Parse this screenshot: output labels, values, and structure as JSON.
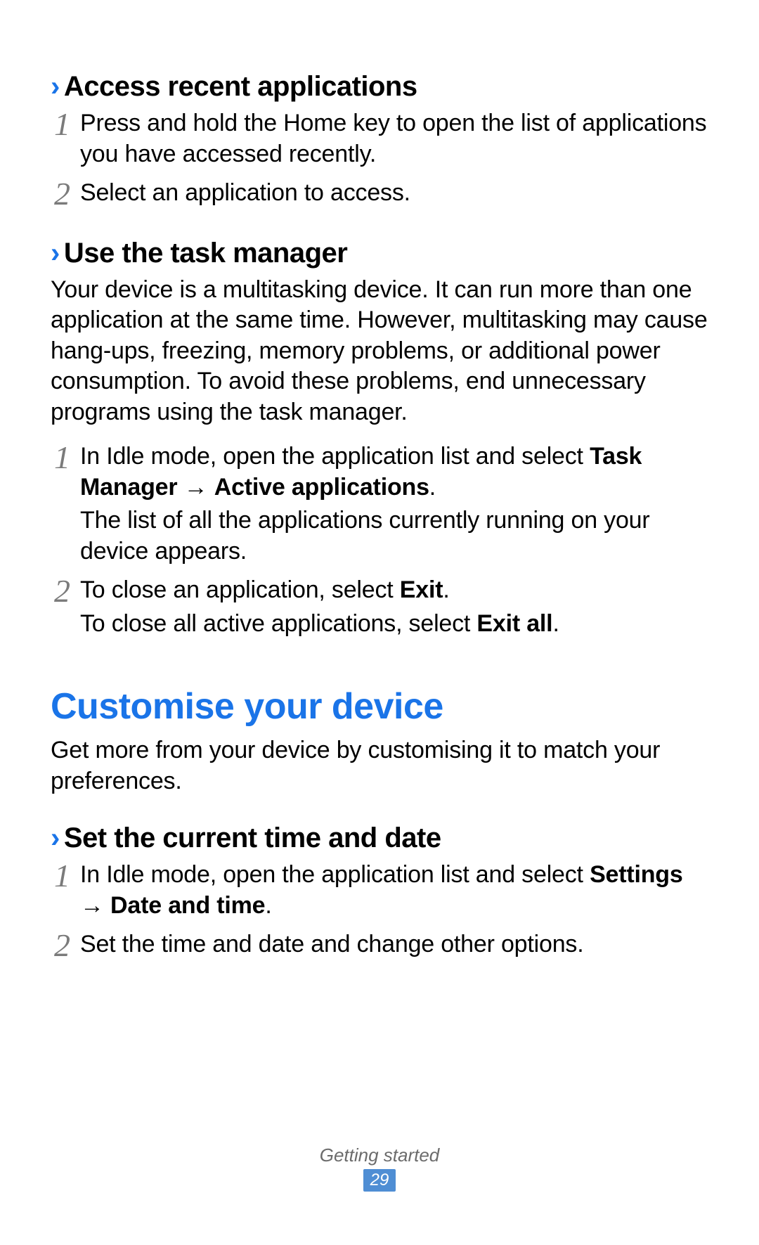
{
  "sections": [
    {
      "heading": "Access recent applications",
      "intro": null,
      "steps": [
        {
          "num": "1",
          "lines": [
            {
              "parts": [
                {
                  "t": "Press and hold the Home key to open the list of applications you have accessed recently."
                }
              ]
            }
          ]
        },
        {
          "num": "2",
          "lines": [
            {
              "parts": [
                {
                  "t": "Select an application to access."
                }
              ]
            }
          ]
        }
      ]
    },
    {
      "heading": "Use the task manager",
      "intro": "Your device is a multitasking device. It can run more than one application at the same time. However, multitasking may cause hang-ups, freezing, memory problems, or additional power consumption. To avoid these problems, end unnecessary programs using the task manager.",
      "steps": [
        {
          "num": "1",
          "lines": [
            {
              "parts": [
                {
                  "t": "In Idle mode, open the application list and select "
                },
                {
                  "t": "Task Manager",
                  "b": true
                },
                {
                  "t": " → "
                },
                {
                  "t": "Active applications",
                  "b": true
                },
                {
                  "t": "."
                }
              ]
            },
            {
              "parts": [
                {
                  "t": "The list of all the applications currently running on your device appears."
                }
              ]
            }
          ]
        },
        {
          "num": "2",
          "lines": [
            {
              "parts": [
                {
                  "t": "To close an application, select "
                },
                {
                  "t": "Exit",
                  "b": true
                },
                {
                  "t": "."
                }
              ]
            },
            {
              "parts": [
                {
                  "t": "To close all active applications, select "
                },
                {
                  "t": "Exit all",
                  "b": true
                },
                {
                  "t": "."
                }
              ]
            }
          ]
        }
      ]
    }
  ],
  "mainSection": {
    "heading": "Customise your device",
    "intro": "Get more from your device by customising it to match your preferences.",
    "subsections": [
      {
        "heading": "Set the current time and date",
        "steps": [
          {
            "num": "1",
            "lines": [
              {
                "parts": [
                  {
                    "t": "In Idle mode, open the application list and select "
                  },
                  {
                    "t": "Settings",
                    "b": true
                  },
                  {
                    "t": " → "
                  },
                  {
                    "t": "Date and time",
                    "b": true
                  },
                  {
                    "t": "."
                  }
                ]
              }
            ]
          },
          {
            "num": "2",
            "lines": [
              {
                "parts": [
                  {
                    "t": "Set the time and date and change other options."
                  }
                ]
              }
            ]
          }
        ]
      }
    ]
  },
  "footer": {
    "chapter": "Getting started",
    "page": "29"
  },
  "chevron": "›"
}
